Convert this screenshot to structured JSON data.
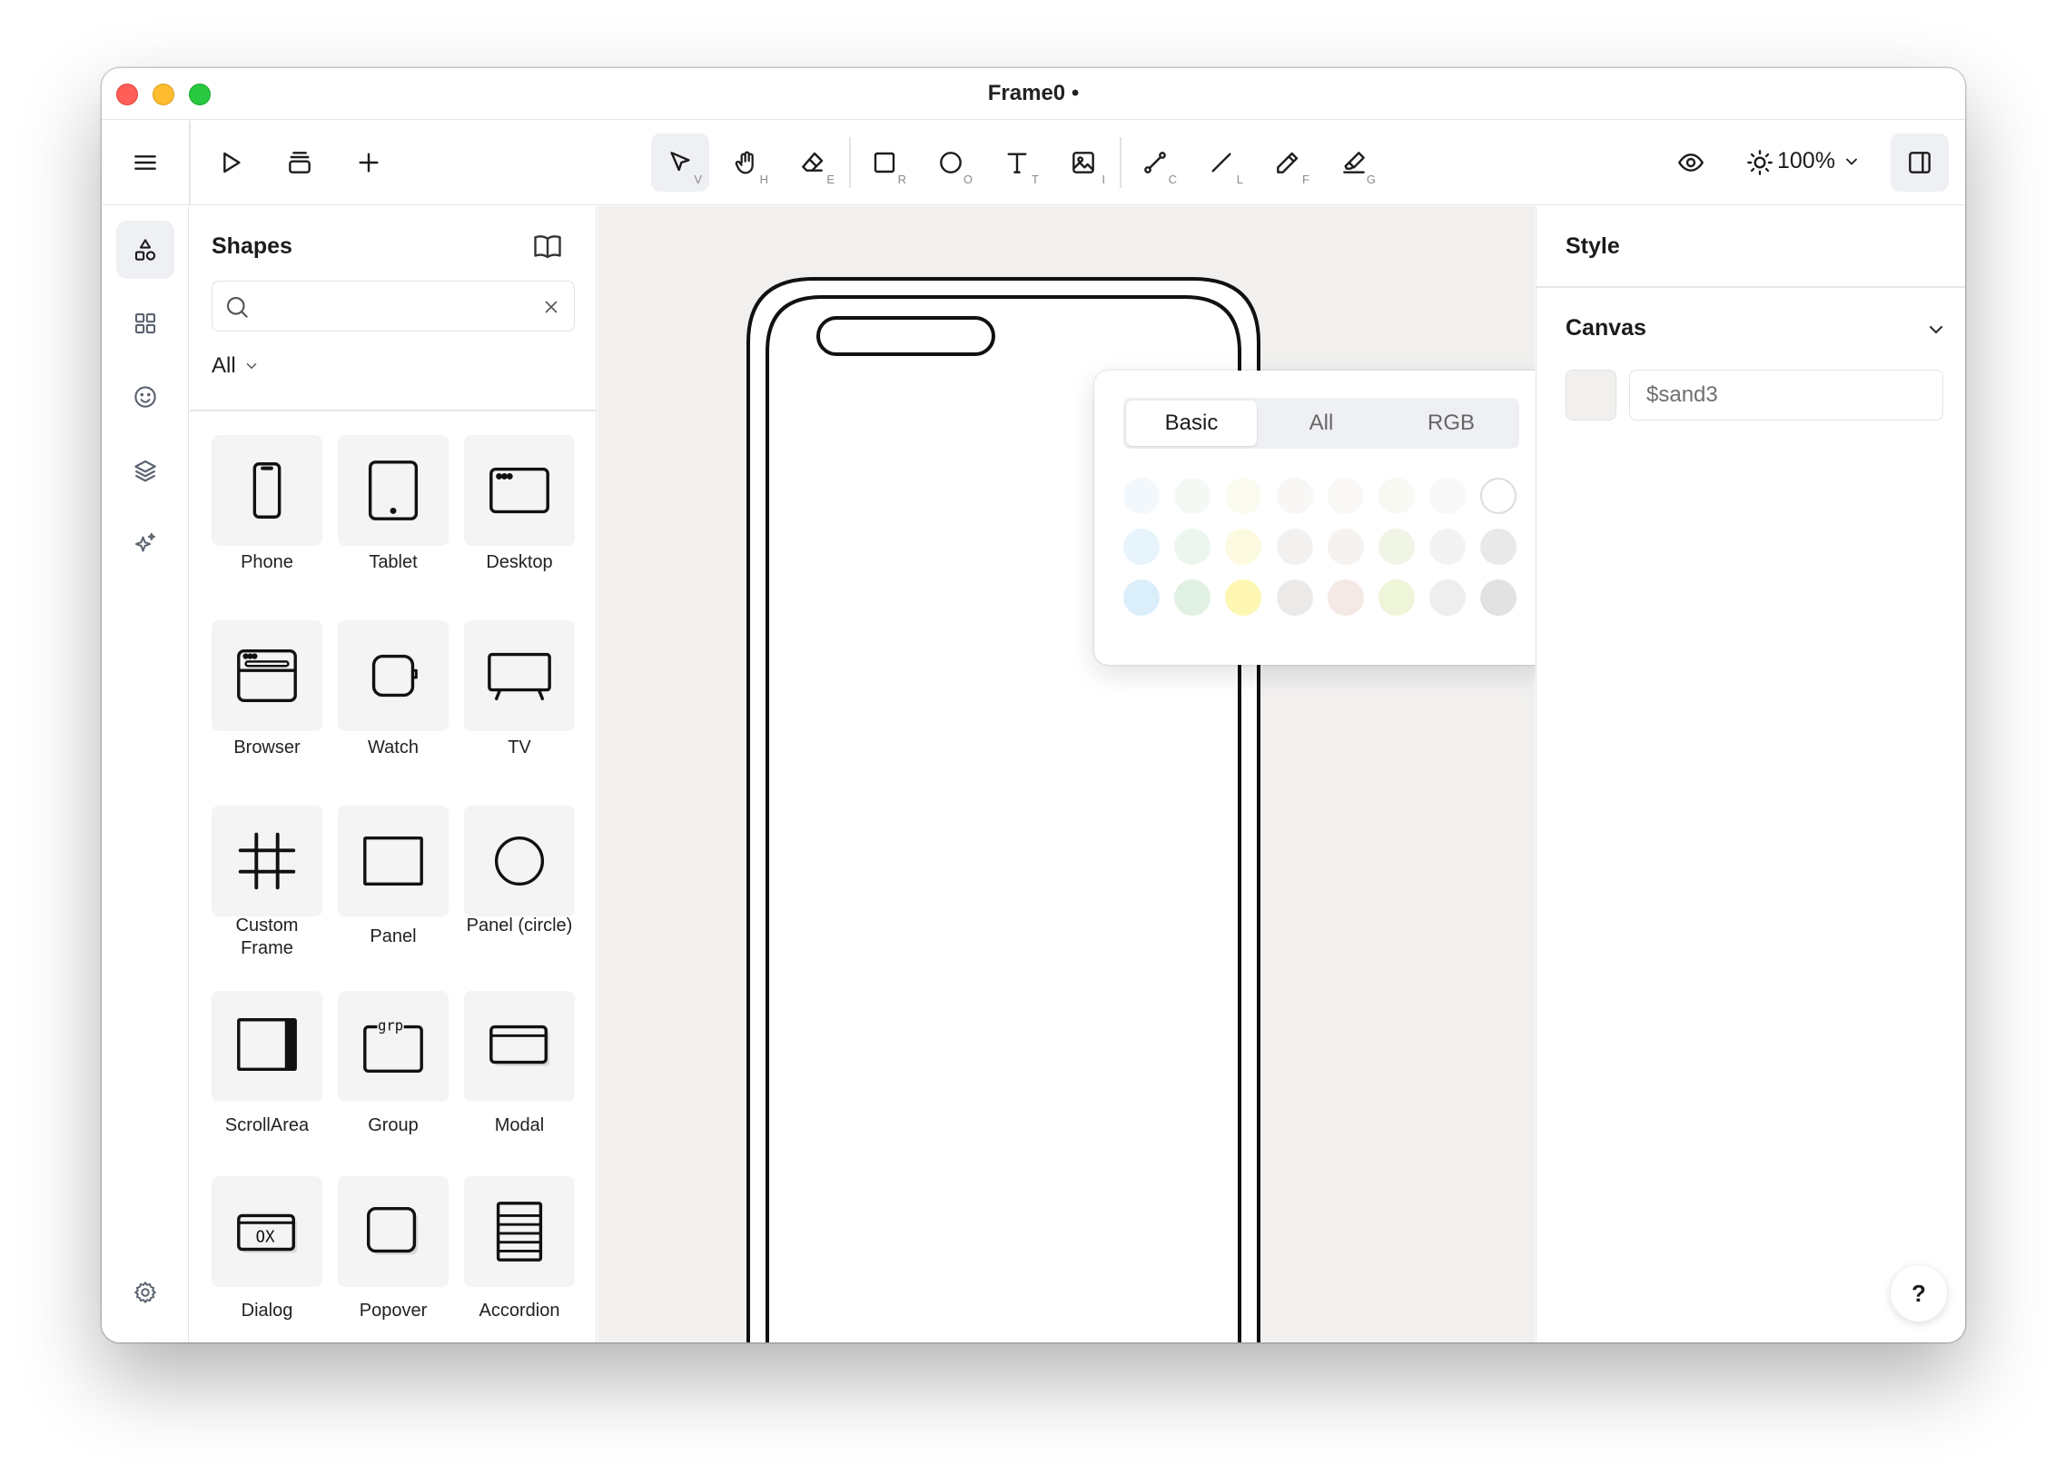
{
  "window": {
    "title": "Frame0 •"
  },
  "toolbar": {
    "tools": [
      {
        "name": "select",
        "shortcut": "V"
      },
      {
        "name": "hand",
        "shortcut": "H"
      },
      {
        "name": "eraser",
        "shortcut": "E"
      },
      {
        "name": "rectangle",
        "shortcut": "R"
      },
      {
        "name": "ellipse",
        "shortcut": "O"
      },
      {
        "name": "text",
        "shortcut": "T"
      },
      {
        "name": "image",
        "shortcut": "I"
      },
      {
        "name": "connector",
        "shortcut": "C"
      },
      {
        "name": "line",
        "shortcut": "L"
      },
      {
        "name": "pencil",
        "shortcut": "F"
      },
      {
        "name": "highlighter",
        "shortcut": "G"
      }
    ],
    "zoom": "100%"
  },
  "shapes_panel": {
    "title": "Shapes",
    "search": {
      "value": "",
      "placeholder": ""
    },
    "filter": "All",
    "items": [
      {
        "label": "Phone"
      },
      {
        "label": "Tablet"
      },
      {
        "label": "Desktop"
      },
      {
        "label": "Browser"
      },
      {
        "label": "Watch"
      },
      {
        "label": "TV"
      },
      {
        "label": "Custom Frame"
      },
      {
        "label": "Panel"
      },
      {
        "label": "Panel (circle)"
      },
      {
        "label": "ScrollArea"
      },
      {
        "label": "Group",
        "glyph": "grp"
      },
      {
        "label": "Modal"
      },
      {
        "label": "Dialog",
        "glyph": "OX"
      },
      {
        "label": "Popover"
      },
      {
        "label": "Accordion"
      }
    ]
  },
  "color_popover": {
    "tabs": [
      "Basic",
      "All",
      "RGB"
    ],
    "active_tab": "Basic",
    "swatches": [
      [
        "#f3f8fd",
        "#f5f9f5",
        "#fbfbf0",
        "#f8f7f6",
        "#faf8f6",
        "#f8f9f2",
        "#f8f8f8",
        "#ffffff"
      ],
      [
        "#e8f4fc",
        "#edf6ee",
        "#fcfbe1",
        "#f2f1f0",
        "#f5f2ef",
        "#f1f5e6",
        "#f3f3f3",
        "#e9e9e9"
      ],
      [
        "#dbeffb",
        "#e0f0e2",
        "#fdf7b3",
        "#eceae8",
        "#f4e9e4",
        "#eef5d8",
        "#eeeeee",
        "#e2e2e2"
      ]
    ]
  },
  "style_panel": {
    "title": "Style",
    "section": "Canvas",
    "canvas_color": "#f1f0ef",
    "canvas_value": "$sand3"
  },
  "help": {
    "label": "?"
  }
}
